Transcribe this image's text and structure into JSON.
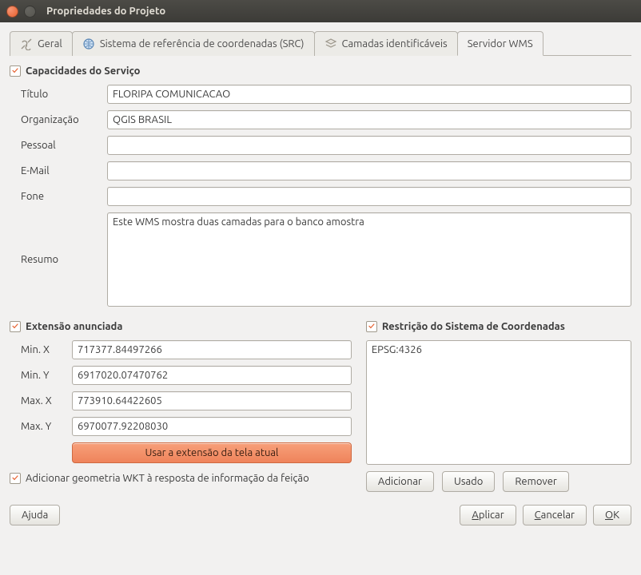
{
  "window": {
    "title": "Propriedades do Projeto"
  },
  "tabs": {
    "general": "Geral",
    "crs": "Sistema de referência de coordenadas (SRC)",
    "layers": "Camadas identificáveis",
    "wms": "Servidor WMS"
  },
  "cap": {
    "title": "Capacidades do Serviço",
    "labels": {
      "titulo": "Título",
      "organizacao": "Organização",
      "pessoal": "Pessoal",
      "email": "E-Mail",
      "fone": "Fone",
      "resumo": "Resumo"
    },
    "values": {
      "titulo": "FLORIPA COMUNICACAO",
      "organizacao": "QGIS BRASIL",
      "pessoal": "",
      "email": "",
      "fone": "",
      "resumo": "Este WMS mostra duas camadas para o banco amostra"
    }
  },
  "ext": {
    "title": "Extensão anunciada",
    "labels": {
      "minx": "Min. X",
      "miny": "Min. Y",
      "maxx": "Max. X",
      "maxy": "Max. Y"
    },
    "values": {
      "minx": "717377.84497266",
      "miny": "6917020.07470762",
      "maxx": "773910.64422605",
      "maxy": "6970077.92208030"
    },
    "use_canvas_btn": "Usar a extensão da tela atual"
  },
  "crs_restrict": {
    "title": "Restrição do Sistema de Coordenadas",
    "items": [
      "EPSG:4326"
    ],
    "buttons": {
      "add": "Adicionar",
      "used": "Usado",
      "remove": "Remover"
    }
  },
  "wkt": {
    "label": "Adicionar geometria WKT à resposta de informação da feição"
  },
  "footer": {
    "help": "Ajuda",
    "apply": "Aplicar",
    "cancel": "Cancelar",
    "ok": "OK"
  }
}
